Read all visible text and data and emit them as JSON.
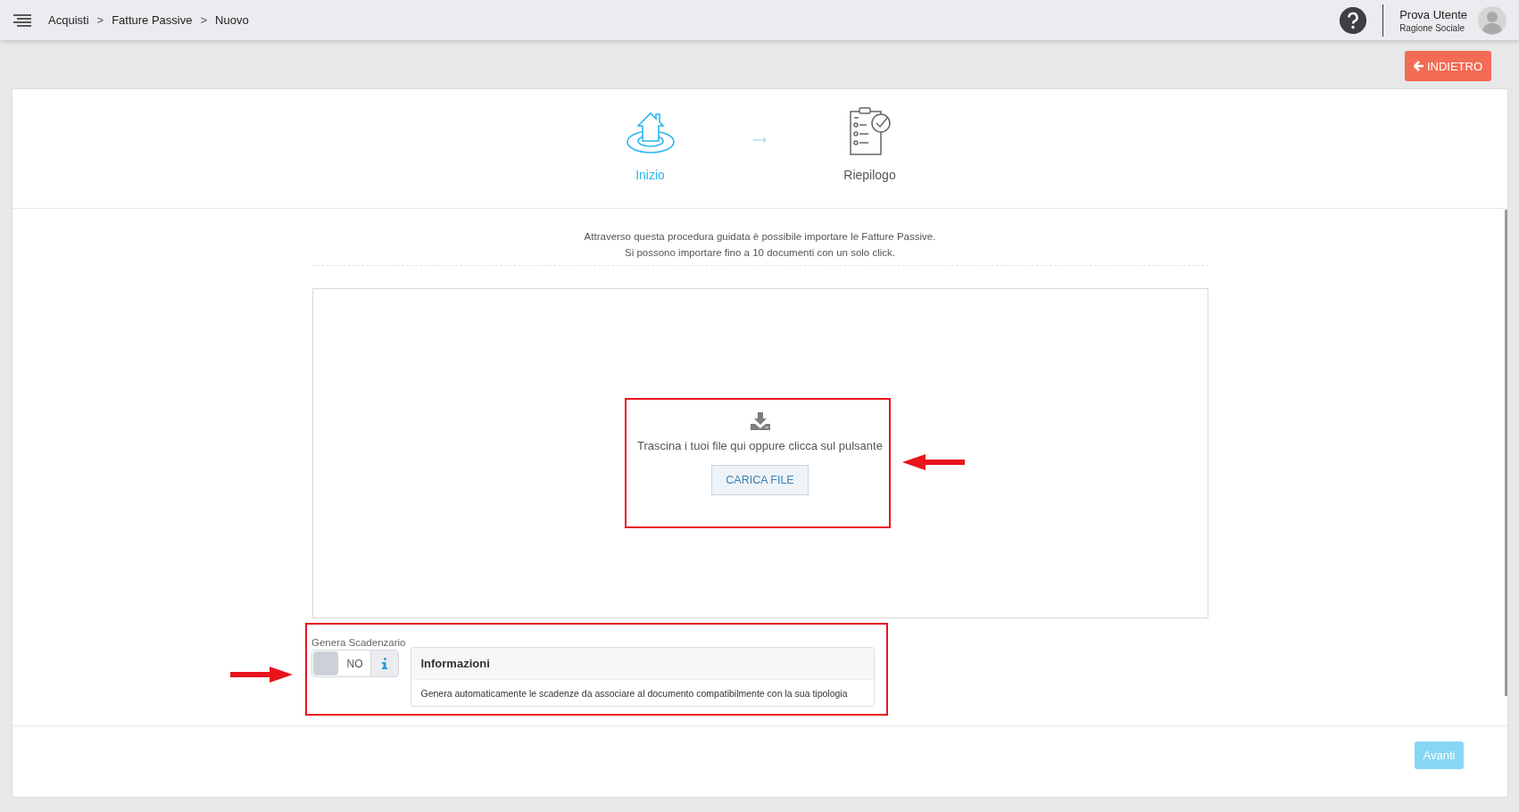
{
  "breadcrumb": [
    {
      "label": "Acquisti"
    },
    {
      "label": "Fatture Passive"
    },
    {
      "label": "Nuovo"
    }
  ],
  "breadcrumb_separator": ">",
  "user": {
    "name": "Prova Utente",
    "company": "Ragione Sociale"
  },
  "back_button": {
    "label": "INDIETRO"
  },
  "steps": [
    {
      "label": "Inizio",
      "kind": "home",
      "selected": true
    },
    {
      "label": "Riepilogo",
      "kind": "checklist",
      "selected": false
    }
  ],
  "intro": [
    "Attraverso questa procedura guidata è possibile importare le Fatture Passive.",
    "Si possono importare fino a 10 documenti con un solo click."
  ],
  "dropzone": {
    "text": "Trascina i tuoi file qui oppure clicca sul pulsante",
    "button": "CARICA FILE"
  },
  "toggle": {
    "label": "Genera Scadenzario",
    "on": false,
    "value": "NO"
  },
  "info_popover": {
    "title": "Informazioni",
    "text": "Genera automaticamente le scadenze da associare al documento compatibilmente con la sua tipologia"
  },
  "next_button": {
    "label": "Avanti",
    "disabled": true
  }
}
